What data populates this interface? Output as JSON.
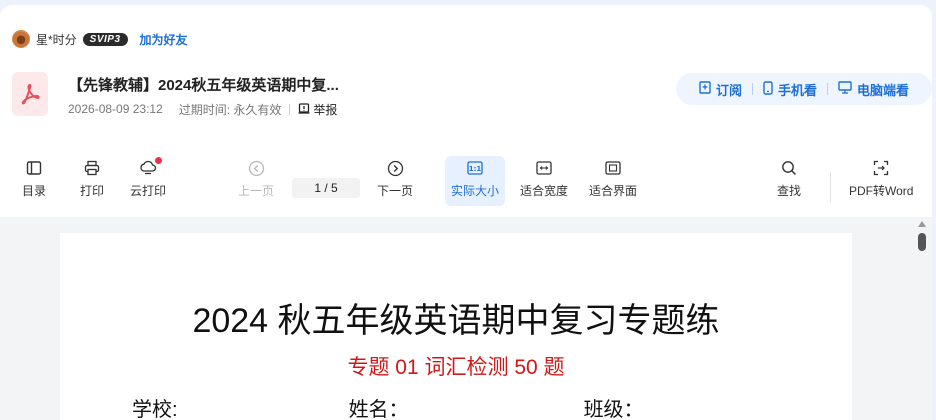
{
  "uploader": {
    "name": "星*时分",
    "vip_badge": "SVIP3",
    "add_friend": "加为好友"
  },
  "document": {
    "title": "【先锋教辅】2024秋五年级英语期中复...",
    "date": "2026-08-09 23:12",
    "expiry_label": "过期时间: 永久有效",
    "report": "举报"
  },
  "view_actions": {
    "subscribe": "订阅",
    "mobile": "手机看",
    "desktop": "电脑端看"
  },
  "toolbar": {
    "toc": "目录",
    "print": "打印",
    "cloud_print": "云打印",
    "prev": "上一页",
    "page_indicator": "1  /  5",
    "next": "下一页",
    "actual_size": "实际大小",
    "fit_width": "适合宽度",
    "fit_page": "适合界面",
    "find": "查找",
    "pdf_to_word": "PDF转Word"
  },
  "page_content": {
    "heading": "2024 秋五年级英语期中复习专题练",
    "subheading": "专题 01  词汇检测 50 题",
    "fields": [
      "学校:",
      "姓名：",
      "班级："
    ]
  },
  "colors": {
    "accent": "#1e6fd9",
    "pdf_red": "#e8505b",
    "subheading_red": "#d01818"
  }
}
